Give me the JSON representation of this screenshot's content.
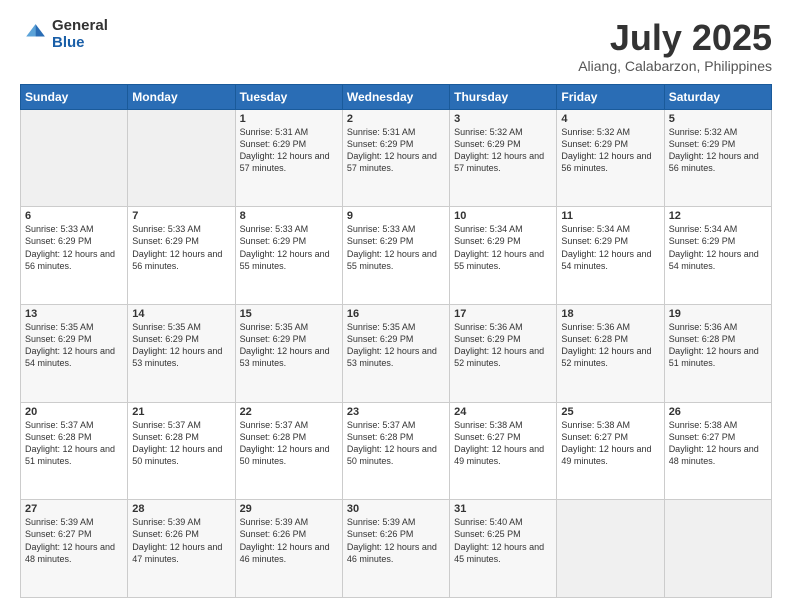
{
  "logo": {
    "general": "General",
    "blue": "Blue"
  },
  "header": {
    "month": "July 2025",
    "location": "Aliang, Calabarzon, Philippines"
  },
  "days_of_week": [
    "Sunday",
    "Monday",
    "Tuesday",
    "Wednesday",
    "Thursday",
    "Friday",
    "Saturday"
  ],
  "weeks": [
    [
      {
        "day": "",
        "info": ""
      },
      {
        "day": "",
        "info": ""
      },
      {
        "day": "1",
        "info": "Sunrise: 5:31 AM\nSunset: 6:29 PM\nDaylight: 12 hours and 57 minutes."
      },
      {
        "day": "2",
        "info": "Sunrise: 5:31 AM\nSunset: 6:29 PM\nDaylight: 12 hours and 57 minutes."
      },
      {
        "day": "3",
        "info": "Sunrise: 5:32 AM\nSunset: 6:29 PM\nDaylight: 12 hours and 57 minutes."
      },
      {
        "day": "4",
        "info": "Sunrise: 5:32 AM\nSunset: 6:29 PM\nDaylight: 12 hours and 56 minutes."
      },
      {
        "day": "5",
        "info": "Sunrise: 5:32 AM\nSunset: 6:29 PM\nDaylight: 12 hours and 56 minutes."
      }
    ],
    [
      {
        "day": "6",
        "info": "Sunrise: 5:33 AM\nSunset: 6:29 PM\nDaylight: 12 hours and 56 minutes."
      },
      {
        "day": "7",
        "info": "Sunrise: 5:33 AM\nSunset: 6:29 PM\nDaylight: 12 hours and 56 minutes."
      },
      {
        "day": "8",
        "info": "Sunrise: 5:33 AM\nSunset: 6:29 PM\nDaylight: 12 hours and 55 minutes."
      },
      {
        "day": "9",
        "info": "Sunrise: 5:33 AM\nSunset: 6:29 PM\nDaylight: 12 hours and 55 minutes."
      },
      {
        "day": "10",
        "info": "Sunrise: 5:34 AM\nSunset: 6:29 PM\nDaylight: 12 hours and 55 minutes."
      },
      {
        "day": "11",
        "info": "Sunrise: 5:34 AM\nSunset: 6:29 PM\nDaylight: 12 hours and 54 minutes."
      },
      {
        "day": "12",
        "info": "Sunrise: 5:34 AM\nSunset: 6:29 PM\nDaylight: 12 hours and 54 minutes."
      }
    ],
    [
      {
        "day": "13",
        "info": "Sunrise: 5:35 AM\nSunset: 6:29 PM\nDaylight: 12 hours and 54 minutes."
      },
      {
        "day": "14",
        "info": "Sunrise: 5:35 AM\nSunset: 6:29 PM\nDaylight: 12 hours and 53 minutes."
      },
      {
        "day": "15",
        "info": "Sunrise: 5:35 AM\nSunset: 6:29 PM\nDaylight: 12 hours and 53 minutes."
      },
      {
        "day": "16",
        "info": "Sunrise: 5:35 AM\nSunset: 6:29 PM\nDaylight: 12 hours and 53 minutes."
      },
      {
        "day": "17",
        "info": "Sunrise: 5:36 AM\nSunset: 6:29 PM\nDaylight: 12 hours and 52 minutes."
      },
      {
        "day": "18",
        "info": "Sunrise: 5:36 AM\nSunset: 6:28 PM\nDaylight: 12 hours and 52 minutes."
      },
      {
        "day": "19",
        "info": "Sunrise: 5:36 AM\nSunset: 6:28 PM\nDaylight: 12 hours and 51 minutes."
      }
    ],
    [
      {
        "day": "20",
        "info": "Sunrise: 5:37 AM\nSunset: 6:28 PM\nDaylight: 12 hours and 51 minutes."
      },
      {
        "day": "21",
        "info": "Sunrise: 5:37 AM\nSunset: 6:28 PM\nDaylight: 12 hours and 50 minutes."
      },
      {
        "day": "22",
        "info": "Sunrise: 5:37 AM\nSunset: 6:28 PM\nDaylight: 12 hours and 50 minutes."
      },
      {
        "day": "23",
        "info": "Sunrise: 5:37 AM\nSunset: 6:28 PM\nDaylight: 12 hours and 50 minutes."
      },
      {
        "day": "24",
        "info": "Sunrise: 5:38 AM\nSunset: 6:27 PM\nDaylight: 12 hours and 49 minutes."
      },
      {
        "day": "25",
        "info": "Sunrise: 5:38 AM\nSunset: 6:27 PM\nDaylight: 12 hours and 49 minutes."
      },
      {
        "day": "26",
        "info": "Sunrise: 5:38 AM\nSunset: 6:27 PM\nDaylight: 12 hours and 48 minutes."
      }
    ],
    [
      {
        "day": "27",
        "info": "Sunrise: 5:39 AM\nSunset: 6:27 PM\nDaylight: 12 hours and 48 minutes."
      },
      {
        "day": "28",
        "info": "Sunrise: 5:39 AM\nSunset: 6:26 PM\nDaylight: 12 hours and 47 minutes."
      },
      {
        "day": "29",
        "info": "Sunrise: 5:39 AM\nSunset: 6:26 PM\nDaylight: 12 hours and 46 minutes."
      },
      {
        "day": "30",
        "info": "Sunrise: 5:39 AM\nSunset: 6:26 PM\nDaylight: 12 hours and 46 minutes."
      },
      {
        "day": "31",
        "info": "Sunrise: 5:40 AM\nSunset: 6:25 PM\nDaylight: 12 hours and 45 minutes."
      },
      {
        "day": "",
        "info": ""
      },
      {
        "day": "",
        "info": ""
      }
    ]
  ]
}
